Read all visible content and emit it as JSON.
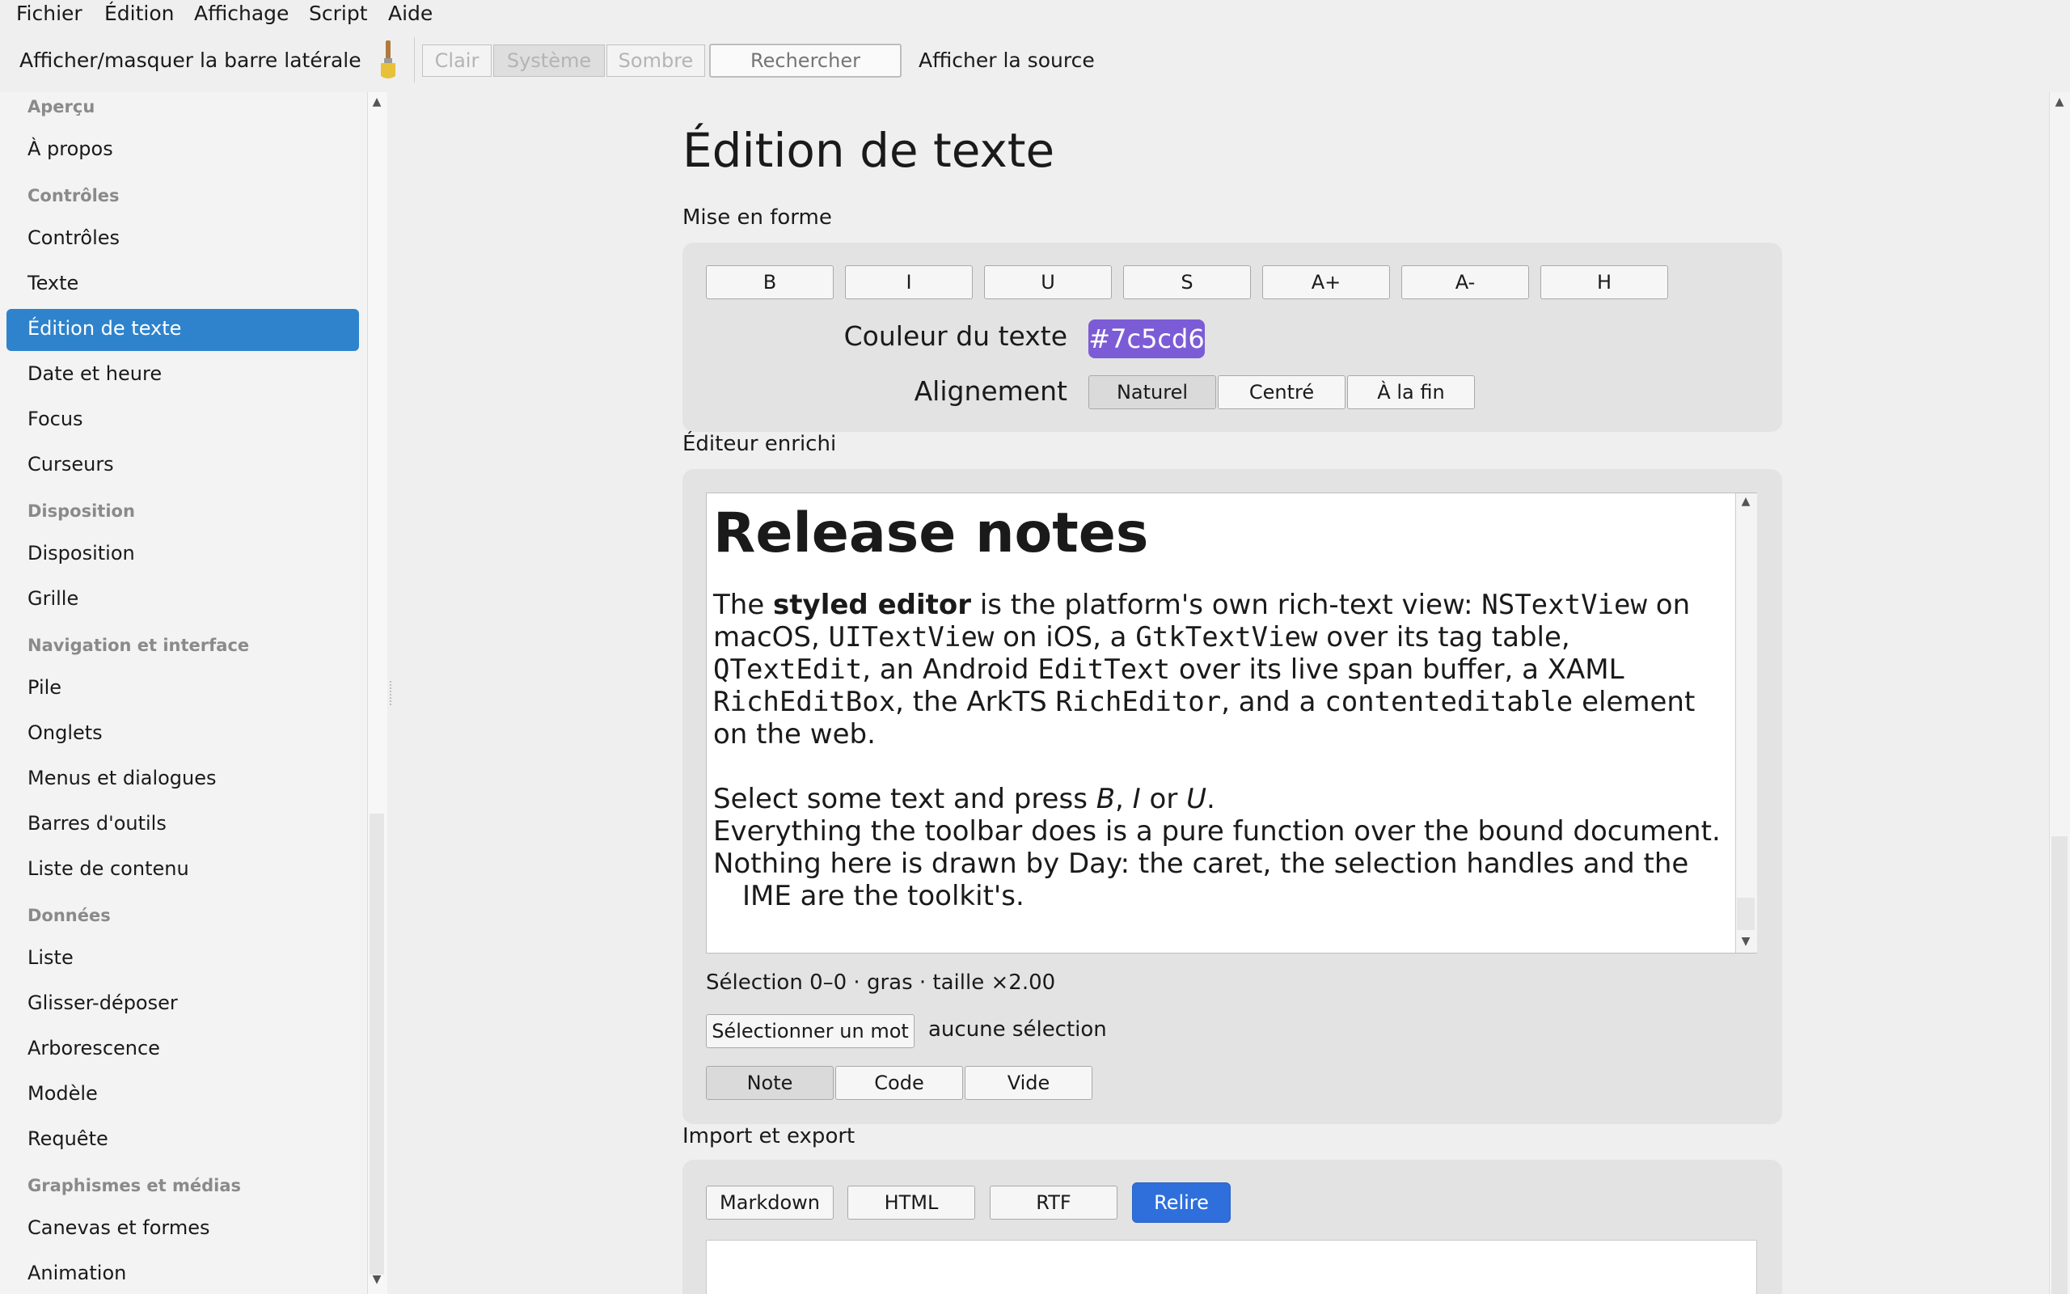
{
  "menubar": {
    "items": [
      "Fichier",
      "Édition",
      "Affichage",
      "Script",
      "Aide"
    ]
  },
  "toolbar": {
    "toggle_sidebar_label": "Afficher/masquer la barre latérale",
    "brush_icon": "paintbrush-icon",
    "theme_buttons": [
      "Clair",
      "Système",
      "Sombre"
    ],
    "theme_selected": "Système",
    "search_placeholder": "Rechercher",
    "view_source_label": "Afficher la source"
  },
  "sidebar": {
    "sections": [
      {
        "header": "Aperçu",
        "items": [
          "À propos"
        ]
      },
      {
        "header": "Contrôles",
        "items": [
          "Contrôles",
          "Texte",
          "Édition de texte",
          "Date et heure",
          "Focus",
          "Curseurs"
        ]
      },
      {
        "header": "Disposition",
        "items": [
          "Disposition",
          "Grille"
        ]
      },
      {
        "header": "Navigation et interface",
        "items": [
          "Pile",
          "Onglets",
          "Menus et dialogues",
          "Barres d'outils",
          "Liste de contenu"
        ]
      },
      {
        "header": "Données",
        "items": [
          "Liste",
          "Glisser-déposer",
          "Arborescence",
          "Modèle",
          "Requête"
        ]
      },
      {
        "header": "Graphismes et médias",
        "items": [
          "Canevas et formes",
          "Animation"
        ]
      }
    ],
    "selected": "Édition de texte"
  },
  "main": {
    "title": "Édition de texte",
    "formatting": {
      "label": "Mise en forme",
      "buttons": [
        "B",
        "I",
        "U",
        "S",
        "A+",
        "A-",
        "H"
      ],
      "text_color_label": "Couleur du texte",
      "text_color_value": "#7c5cd6",
      "alignment_label": "Alignement",
      "alignment_options": [
        "Naturel",
        "Centré",
        "À la fin"
      ],
      "alignment_selected": "Naturel"
    },
    "rich_editor": {
      "label": "Éditeur enrichi",
      "heading": "Release notes",
      "p1": {
        "t1": "The ",
        "b1": "styled editor",
        "t2": " is the platform's own rich-text view: ",
        "c1": "NSTextView",
        "t3": " on macOS, ",
        "c2": "UITextView",
        "t4": " on iOS, a ",
        "c3": "GtkTextView",
        "t5": " over its tag table, ",
        "c4": "QTextEdit",
        "t6": ", an Android ",
        "c5": "EditText",
        "t7": " over its live span buffer, a XAML ",
        "c6": "RichEditBox",
        "t8": ", the ArkTS ",
        "c7": "RichEditor",
        "t9": ", and a ",
        "c8": "contenteditable",
        "t10": " element on the web."
      },
      "p2": {
        "t1": "Select some text and press ",
        "i1": "B",
        "t2": ", ",
        "i2": "I",
        "t3": " or ",
        "i3": "U",
        "t4": ".",
        "line2": "Everything the toolbar does is a pure function over the bound document.",
        "line3": "Nothing here is drawn by Day: the caret, the selection handles and the",
        "line4": "IME are the toolkit's."
      },
      "status": "Sélection 0–0 · gras · taille ×2.00",
      "select_word_button": "Sélectionner un mot",
      "selection_text": "aucune sélection",
      "presets": [
        "Note",
        "Code",
        "Vide"
      ],
      "preset_selected": "Note"
    },
    "import_export": {
      "label": "Import et export",
      "buttons": [
        "Markdown",
        "HTML",
        "RTF"
      ],
      "reload_button": "Relire"
    }
  },
  "colors": {
    "accent": "#2f83cc",
    "primary_button": "#2e6fdc",
    "text_color_swatch": "#7c5cd6"
  }
}
